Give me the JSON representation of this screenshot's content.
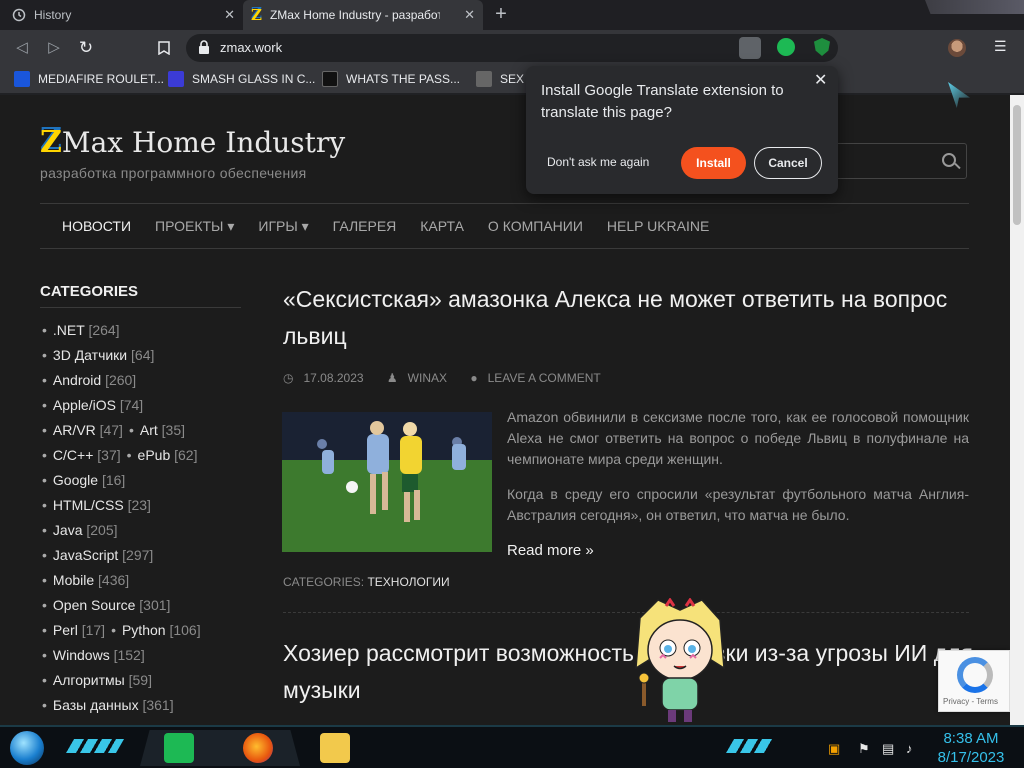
{
  "browser": {
    "tabs": [
      {
        "title": "History"
      },
      {
        "title": "ZMax Home Industry - разработка"
      }
    ],
    "url": "zmax.work",
    "bookmarks": [
      {
        "label": "MEDIAFIRE ROULET..."
      },
      {
        "label": "SMASH GLASS IN C..."
      },
      {
        "label": "WHATS THE PASS..."
      },
      {
        "label": "SEX I"
      }
    ]
  },
  "translate_popup": {
    "message": "Install Google Translate extension to translate this page?",
    "dont_ask_label": "Don't ask me again",
    "install_label": "Install",
    "cancel_label": "Cancel"
  },
  "site": {
    "logo_letter": "Z",
    "logo_title": "Max Home Industry",
    "tagline": "разработка программного обеспечения",
    "nav": [
      {
        "label": "НОВОСТИ"
      },
      {
        "label": "ПРОЕКТЫ ▾"
      },
      {
        "label": "ИГРЫ ▾"
      },
      {
        "label": "ГАЛЕРЕЯ"
      },
      {
        "label": "КАРТА"
      },
      {
        "label": "О КОМПАНИИ"
      },
      {
        "label": "HELP UKRAINE"
      }
    ]
  },
  "sidebar": {
    "heading": "CATEGORIES",
    "rows": [
      [
        {
          "name": ".NET",
          "count": "[264]"
        }
      ],
      [
        {
          "name": "3D Датчики",
          "count": "[64]"
        }
      ],
      [
        {
          "name": "Android",
          "count": "[260]"
        }
      ],
      [
        {
          "name": "Apple/iOS",
          "count": "[74]"
        }
      ],
      [
        {
          "name": "AR/VR",
          "count": "[47]"
        },
        {
          "name": "Art",
          "count": "[35]"
        }
      ],
      [
        {
          "name": "C/C++",
          "count": "[37]"
        },
        {
          "name": "ePub",
          "count": "[62]"
        }
      ],
      [
        {
          "name": "Google",
          "count": "[16]"
        }
      ],
      [
        {
          "name": "HTML/CSS",
          "count": "[23]"
        }
      ],
      [
        {
          "name": "Java",
          "count": "[205]"
        }
      ],
      [
        {
          "name": "JavaScript",
          "count": "[297]"
        }
      ],
      [
        {
          "name": "Mobile",
          "count": "[436]"
        }
      ],
      [
        {
          "name": "Open Source",
          "count": "[301]"
        }
      ],
      [
        {
          "name": "Perl",
          "count": "[17]"
        },
        {
          "name": "Python",
          "count": "[106]"
        }
      ],
      [
        {
          "name": "Windows",
          "count": "[152]"
        }
      ],
      [
        {
          "name": "Алгоритмы",
          "count": "[59]"
        }
      ],
      [
        {
          "name": "Базы данных",
          "count": "[361]"
        }
      ]
    ]
  },
  "post": {
    "title": "«Сексистская» амазонка Алекса не может ответить на вопрос львиц",
    "date": "17.08.2023",
    "author": "WINAX",
    "comment_label": "LEAVE A COMMENT",
    "paragraph1": "Amazon обвинили в сексизме после того, как ее голосовой помощник Alexa не смог ответить на вопрос о победе Львиц в полуфинале на чемпионате мира среди женщин.",
    "paragraph2": "Когда в среду его спросили «результат футбольного матча Англия-Австралия сегодня», он ответил, что матча не было.",
    "read_more": "Read more »",
    "categories_label": "CATEGORIES:",
    "category": "ТЕХНОЛОГИИ"
  },
  "post2": {
    "title": "Хозиер рассмотрит возможность остановки из-за угрозы ИИ для музыки"
  },
  "recaptcha": {
    "privacy": "Privacy - Terms"
  },
  "taskbar": {
    "time": "8:38 AM",
    "date": "8/17/2023"
  }
}
